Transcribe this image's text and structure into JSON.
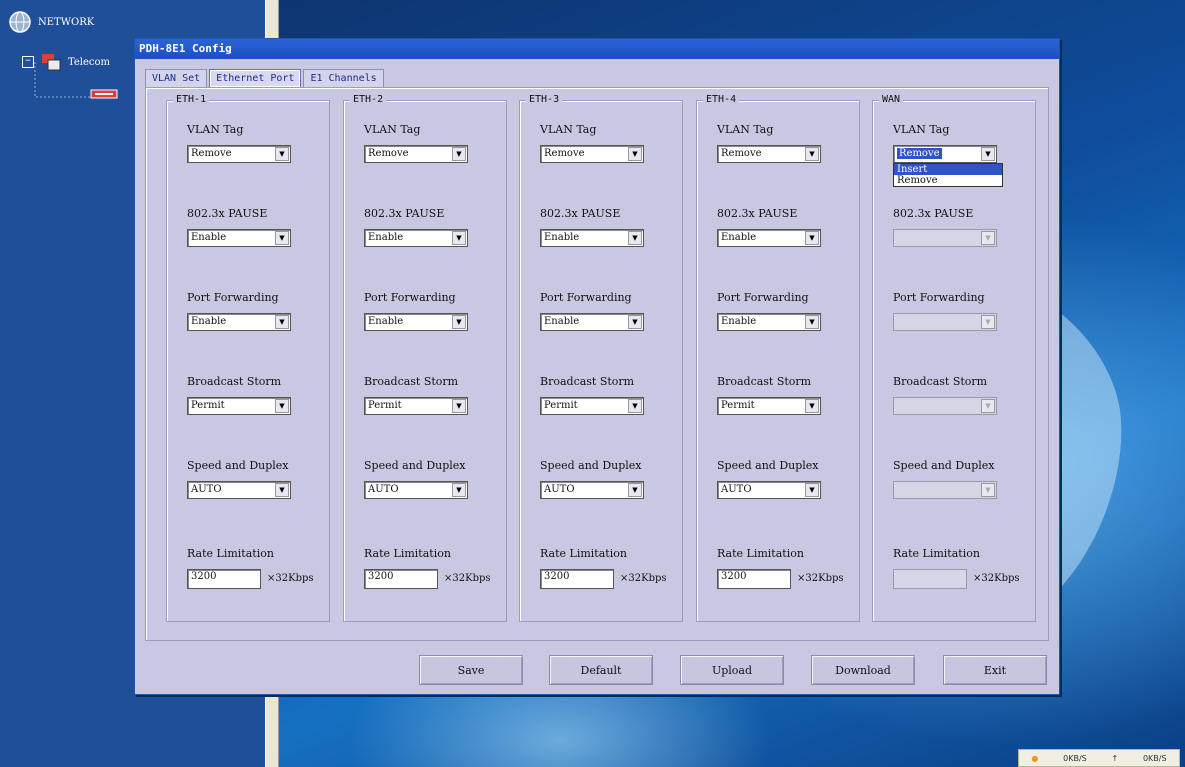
{
  "tree": {
    "root_label": "NETWORK",
    "child_label": "Telecom"
  },
  "dialog": {
    "title": "PDH-8E1 Config",
    "tabs": [
      {
        "label": "VLAN Set",
        "active": false
      },
      {
        "label": "Ethernet Port",
        "active": true
      },
      {
        "label": "E1 Channels",
        "active": false
      }
    ]
  },
  "field_labels": {
    "vlan_tag": "VLAN Tag",
    "pause": "802.3x PAUSE",
    "port_forwarding": "Port Forwarding",
    "broadcast_storm": "Broadcast Storm",
    "speed_duplex": "Speed and Duplex",
    "rate_limitation": "Rate Limitation",
    "rate_unit": "×32Kbps"
  },
  "ports": [
    {
      "name": "ETH-1",
      "vlan_tag": "Remove",
      "pause": "Enable",
      "port_forwarding": "Enable",
      "broadcast_storm": "Permit",
      "speed_duplex": "AUTO",
      "rate": "3200"
    },
    {
      "name": "ETH-2",
      "vlan_tag": "Remove",
      "pause": "Enable",
      "port_forwarding": "Enable",
      "broadcast_storm": "Permit",
      "speed_duplex": "AUTO",
      "rate": "3200"
    },
    {
      "name": "ETH-3",
      "vlan_tag": "Remove",
      "pause": "Enable",
      "port_forwarding": "Enable",
      "broadcast_storm": "Permit",
      "speed_duplex": "AUTO",
      "rate": "3200"
    },
    {
      "name": "ETH-4",
      "vlan_tag": "Remove",
      "pause": "Enable",
      "port_forwarding": "Enable",
      "broadcast_storm": "Permit",
      "speed_duplex": "AUTO",
      "rate": "3200"
    },
    {
      "name": "WAN",
      "vlan_tag": "Remove",
      "pause": "",
      "port_forwarding": "",
      "broadcast_storm": "",
      "speed_duplex": "",
      "rate": ""
    }
  ],
  "wan_dropdown_options": [
    "Insert",
    "Remove"
  ],
  "buttons": {
    "save": "Save",
    "default": "Default",
    "upload": "Upload",
    "download": "Download",
    "exit": "Exit"
  },
  "status": {
    "left": "0KB/S",
    "sep": "↑",
    "right": "0KB/S"
  },
  "colors": {
    "dialog_bg": "#c8c8e2",
    "titlebar": "#2b64d8",
    "selection": "#2f54c6"
  }
}
